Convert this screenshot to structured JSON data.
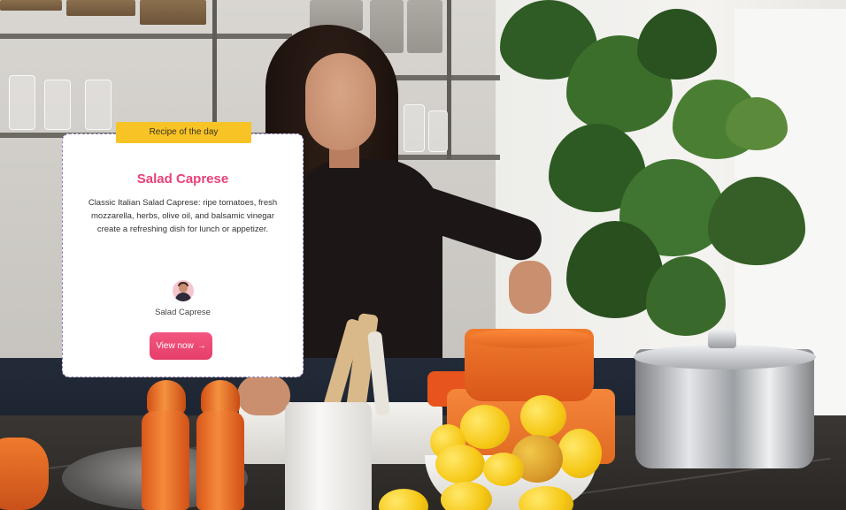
{
  "card": {
    "badge": "Recipe of the day",
    "title": "Salad Caprese",
    "description": "Classic Italian Salad Caprese: ripe tomatoes, fresh mozzarella, herbs, olive oil, and balsamic vinegar create a refreshing dish for lunch or appetizer.",
    "author_name": "Salad Caprese",
    "cta_label": "View now",
    "cta_icon": "arrow-right-icon"
  },
  "colors": {
    "badge_bg": "#f8c324",
    "title": "#e8407a",
    "cta_bg": "#e63d6c",
    "avatar_bg": "#f6c6cf"
  },
  "background": {
    "image_subject": "woman-cooking-in-kitchen-photo"
  }
}
